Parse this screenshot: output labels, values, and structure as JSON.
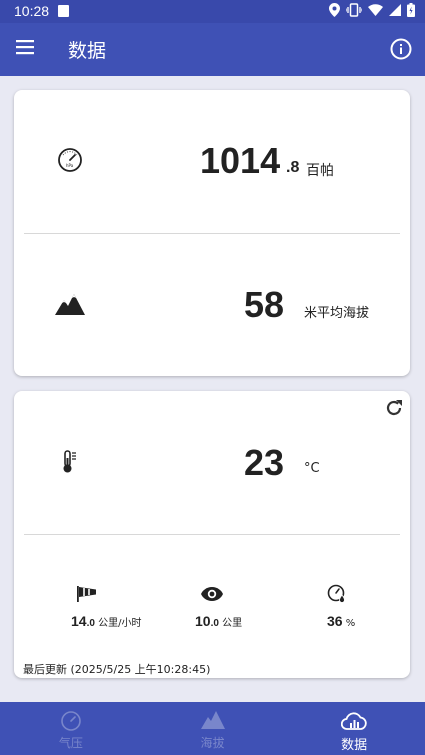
{
  "status_bar": {
    "time": "10:28"
  },
  "app_bar": {
    "title": "数据"
  },
  "pressure": {
    "integer": "1014",
    "decimal": ".8",
    "unit": "百帕"
  },
  "altitude": {
    "value": "58",
    "unit": "米平均海拔"
  },
  "temperature": {
    "value": "23",
    "unit": "°C"
  },
  "wind": {
    "integer": "14",
    "decimal": ".0",
    "unit": "公里/小时"
  },
  "visibility": {
    "integer": "10",
    "decimal": ".0",
    "unit": "公里"
  },
  "humidity": {
    "value": "36",
    "unit": "%"
  },
  "last_updated": "最后更新 (2025/5/25 上午10:28:45)",
  "nav": [
    {
      "label": "气压",
      "icon": "gauge-icon",
      "active": false
    },
    {
      "label": "海拔",
      "icon": "mountain-icon",
      "active": false
    },
    {
      "label": "数据",
      "icon": "weather-data-icon",
      "active": true
    }
  ],
  "colors": {
    "primary": "#3f51b5",
    "status_bar": "#3949ab",
    "background": "#e8e9f3",
    "nav_inactive": "#7986cb"
  }
}
